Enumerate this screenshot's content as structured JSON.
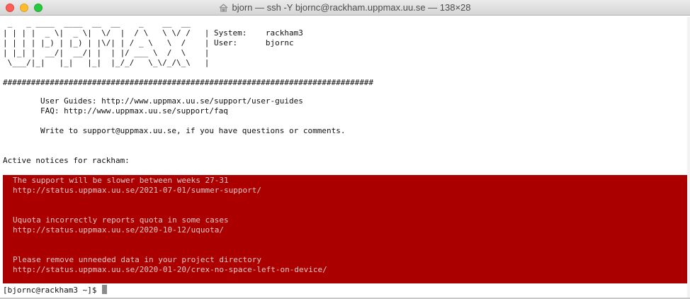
{
  "window": {
    "title": "bjorn — ssh -Y bjornc@rackham.uppmax.uu.se — 138×28",
    "icon": "home-folder-icon"
  },
  "banner": {
    "ascii": [
      " _   _ ____  ____  __  __    _    __  __",
      "| | | |  _ \\|  _ \\|  \\/  |  / \\   \\ \\/ /   | System:    rackham3",
      "| | | | |_) | |_) | |\\/| | / _ \\   \\  /    | User:      bjornc",
      "| |_| |  __/|  __/| |  | |/ ___ \\  /  \\    |",
      " \\___/|_|   |_|   |_|  |_/_/   \\_\\/_/\\_\\   |"
    ],
    "separator": "###############################################################################"
  },
  "info": {
    "user_guides": "        User Guides: http://www.uppmax.uu.se/support/user-guides",
    "faq": "        FAQ: http://www.uppmax.uu.se/support/faq",
    "contact": "        Write to support@uppmax.uu.se, if you have questions or comments."
  },
  "notices": {
    "header": "Active notices for rackham:",
    "background_color": "#aa0000",
    "items": [
      {
        "title": "The support will be slower between weeks 27-31",
        "url": "http://status.uppmax.uu.se/2021-07-01/summer-support/"
      },
      {
        "title": "Uquota incorrectly reports quota in some cases",
        "url": "http://status.uppmax.uu.se/2020-10-12/uquota/"
      },
      {
        "title": "Please remove unneeded data in your project directory",
        "url": "http://status.uppmax.uu.se/2020-01-20/crex-no-space-left-on-device/"
      }
    ]
  },
  "prompt": {
    "text": "[bjornc@rackham3 ~]$ "
  }
}
